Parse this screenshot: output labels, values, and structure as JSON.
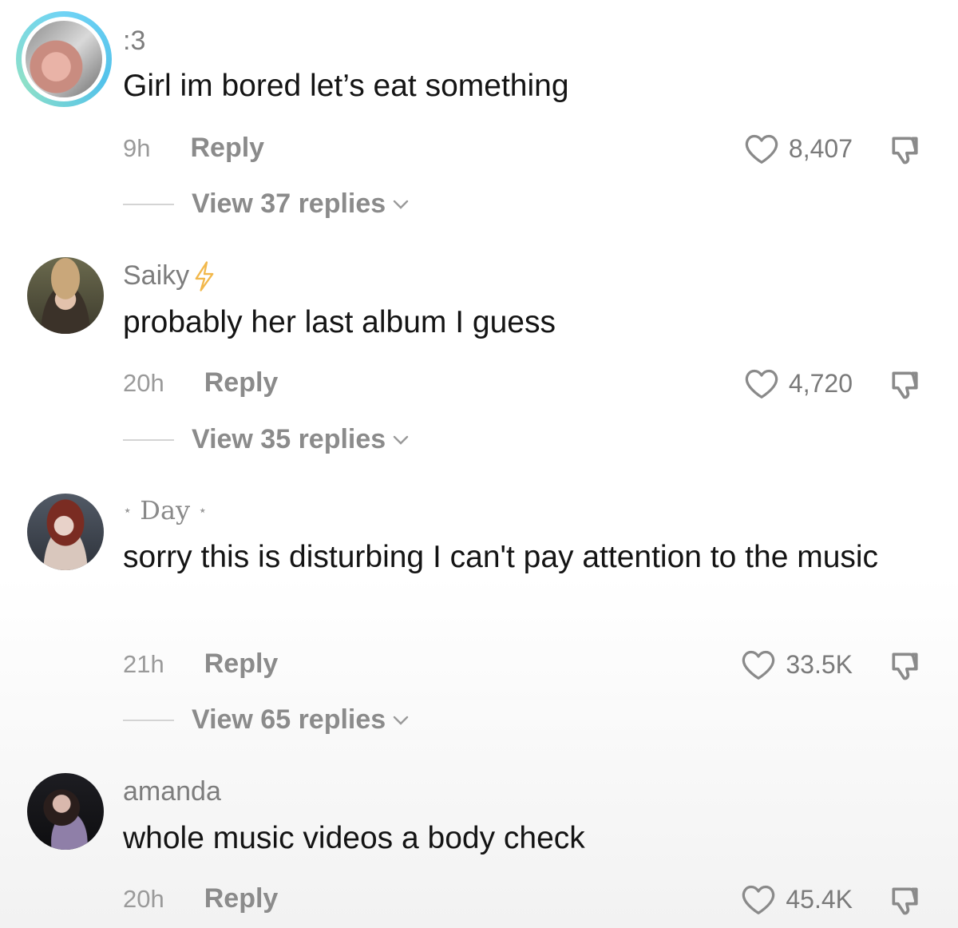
{
  "comments": [
    {
      "username": ":3",
      "text": "Girl im bored let’s eat something",
      "time": "9h",
      "reply_label": "Reply",
      "likes": "8,407",
      "view_replies": "View 37 replies",
      "avatar_style": "story-ring"
    },
    {
      "username": "Saiky",
      "username_badge": "lightning-icon",
      "text": "probably her last album I guess",
      "time": "20h",
      "reply_label": "Reply",
      "likes": "4,720",
      "view_replies": "View 35 replies"
    },
    {
      "username": "Day",
      "username_decoration": "⋆",
      "text": "sorry this is disturbing I can't pay attention to the music",
      "time": "21h",
      "reply_label": "Reply",
      "likes": "33.5K",
      "view_replies": "View 65 replies"
    },
    {
      "username": "amanda",
      "text": "whole music videos a body check",
      "time": "20h",
      "reply_label": "Reply",
      "likes": "45.4K"
    }
  ],
  "colors": {
    "username": "#7d7d7d",
    "body_text": "#141414",
    "secondary": "#8b8b8b",
    "ring": "#53c2ea",
    "bolt": "#f2b84b"
  }
}
